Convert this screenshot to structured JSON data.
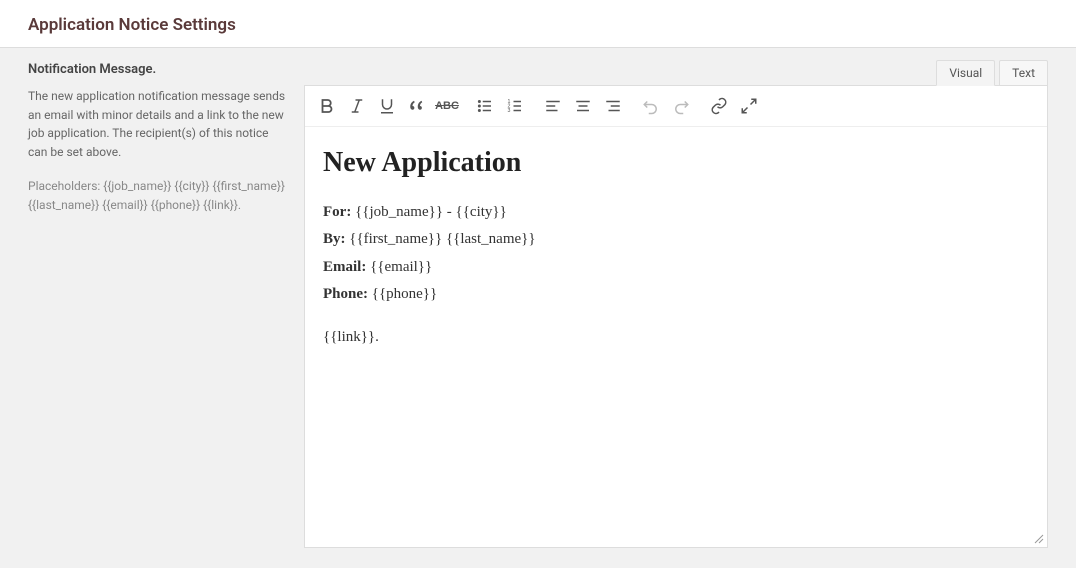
{
  "page": {
    "title": "Application Notice Settings"
  },
  "sidebar": {
    "heading": "Notification Message.",
    "description": "The new application notification message sends an email with minor details and a link to the new job application. The recipient(s) of this notice can be set above.",
    "placeholders_text": "Placeholders: {{job_name}} {{city}} {{first_name}} {{last_name}} {{email}} {{phone}} {{link}}."
  },
  "editor": {
    "tabs": {
      "visual": "Visual",
      "text": "Text"
    },
    "content": {
      "title": "New Application",
      "line1_label": "For:",
      "line1_value": "{{job_name}} - {{city}}",
      "line2_label": "By:",
      "line2_value": "{{first_name}} {{last_name}}",
      "line3_label": "Email:",
      "line3_value": "{{email}}",
      "line4_label": "Phone:",
      "line4_value": "{{phone}}",
      "line5": "{{link}}."
    }
  }
}
